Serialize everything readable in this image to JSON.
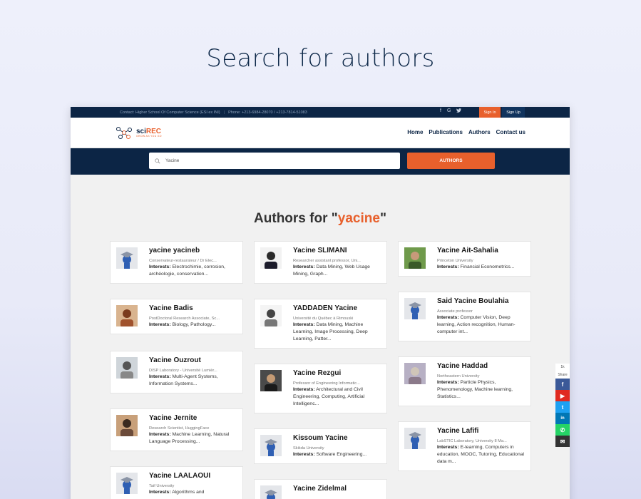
{
  "page_heading": "Search for authors",
  "topbar": {
    "contact": "Contact: Higher School Of Computer Science (ESI ex INI)",
    "phone": "Phone: +213-6984-28070 / +213-7814-51083",
    "signin": "Sign In",
    "signup": "Sign Up"
  },
  "logo": {
    "name_prefix": "sci",
    "name_suffix": "REC",
    "tagline": "GROW AS YOU GO"
  },
  "nav": {
    "home": "Home",
    "publications": "Publications",
    "authors": "Authors",
    "contact": "Contact us"
  },
  "search": {
    "value": "Yacine",
    "button": "AUTHORS"
  },
  "results": {
    "prefix": "Authors for \"",
    "query": "yacine",
    "suffix": "\""
  },
  "interests_label": "Interests:",
  "authors": [
    {
      "name": "yacine yacineb",
      "aff": "Conservateur-restaurateur / Dr Elec...",
      "interests": "Electrochimie, corrosion, archéologie, conservation..."
    },
    {
      "name": "Yacine Badis",
      "aff": "PostDoctoral Research Associate, Sc...",
      "interests": "Biology, Pathology..."
    },
    {
      "name": "Yacine Ouzrout",
      "aff": "DISP Laboratory - Université Lumièr...",
      "interests": "Multi-Agent Systems, Information Systems..."
    },
    {
      "name": "Yacine Jernite",
      "aff": "Research Scientist, HuggingFace",
      "interests": "Machine Learning, Natural Language Processing..."
    },
    {
      "name": "Yacine LAALAOUI",
      "aff": "Taif University",
      "interests": "Algorithms and"
    },
    {
      "name": "Yacine SLIMANI",
      "aff": "Researcher assistant professor, Uni...",
      "interests": "Data Mining, Web Usage Mining, Graph..."
    },
    {
      "name": "YADDADEN Yacine",
      "aff": "Université du Québec à Rimouski",
      "interests": "Data Mining, Machine Learning, Image Processing, Deep Learning, Patter..."
    },
    {
      "name": "Yacine Rezgui",
      "aff": "Professor of Engineering Informatic...",
      "interests": "Architectural and Civil Engineering, Computing, Artificial Intelligenc..."
    },
    {
      "name": "Kissoum Yacine",
      "aff": "Skikda University",
      "interests": "Software Engineering..."
    },
    {
      "name": "Yacine Zidelmal",
      "aff": "",
      "interests": ""
    },
    {
      "name": "Yacine Ait-Sahalia",
      "aff": "Princeton University",
      "interests": "Financial Econometrics..."
    },
    {
      "name": "Said Yacine Boulahia",
      "aff": "Associate professor",
      "interests": "Computer Vision, Deep learning, Action recognition, Human-computer int..."
    },
    {
      "name": "Yacine Haddad",
      "aff": "Northeastern University",
      "interests": "Particle Physics, Phenomenology, Machine learning, Statistics..."
    },
    {
      "name": "Yacine Lafifi",
      "aff": "LabSTIC Laboratory, University 8 Ma...",
      "interests": "E-learning, Computers in education, MOOC, Tutoring, Educational data m..."
    }
  ],
  "share": {
    "count": "1k",
    "label": "Share"
  },
  "colors": {
    "navy": "#0c2545",
    "accent": "#e8602c"
  }
}
